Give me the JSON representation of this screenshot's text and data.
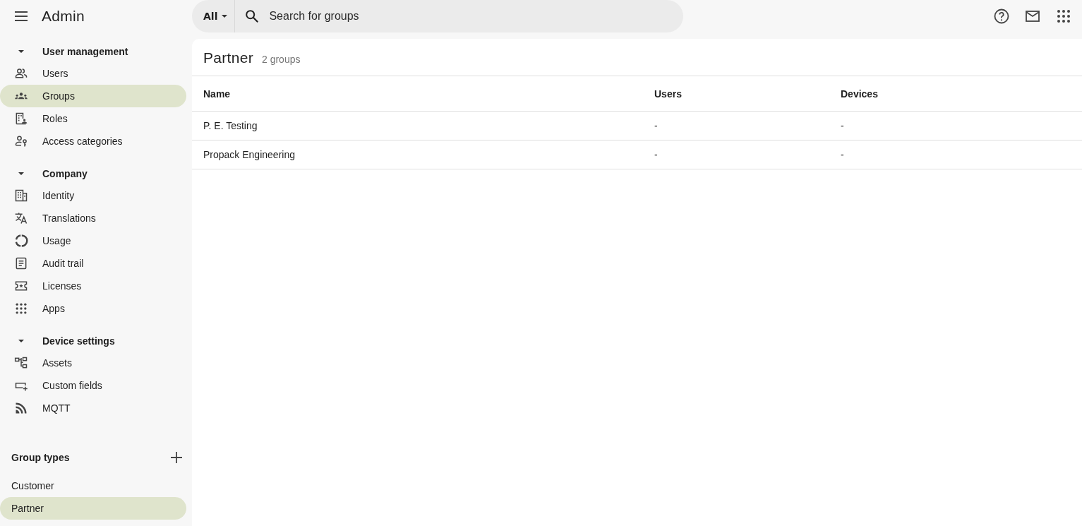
{
  "app": {
    "title": "Admin"
  },
  "search": {
    "scope": "All",
    "placeholder": "Search for groups"
  },
  "sidebar": {
    "sections": [
      {
        "title": "User management",
        "expanded": true,
        "items": [
          {
            "label": "Users",
            "selected": false
          },
          {
            "label": "Groups",
            "selected": true
          },
          {
            "label": "Roles",
            "selected": false
          },
          {
            "label": "Access categories",
            "selected": false
          }
        ]
      },
      {
        "title": "Company",
        "expanded": true,
        "items": [
          {
            "label": "Identity",
            "selected": false
          },
          {
            "label": "Translations",
            "selected": false
          },
          {
            "label": "Usage",
            "selected": false
          },
          {
            "label": "Audit trail",
            "selected": false
          },
          {
            "label": "Licenses",
            "selected": false
          },
          {
            "label": "Apps",
            "selected": false
          }
        ]
      },
      {
        "title": "Device settings",
        "expanded": true,
        "items": [
          {
            "label": "Assets",
            "selected": false
          },
          {
            "label": "Custom fields",
            "selected": false
          },
          {
            "label": "MQTT",
            "selected": false
          }
        ]
      }
    ],
    "group_types": {
      "title": "Group types",
      "items": [
        {
          "label": "Customer",
          "selected": false
        },
        {
          "label": "Partner",
          "selected": true
        }
      ]
    }
  },
  "page": {
    "title": "Partner",
    "count": "2 groups"
  },
  "table": {
    "columns": [
      "Name",
      "Users",
      "Devices"
    ],
    "rows": [
      [
        "P. E. Testing",
        "-",
        "-"
      ],
      [
        "Propack Engineering",
        "-",
        "-"
      ]
    ]
  }
}
